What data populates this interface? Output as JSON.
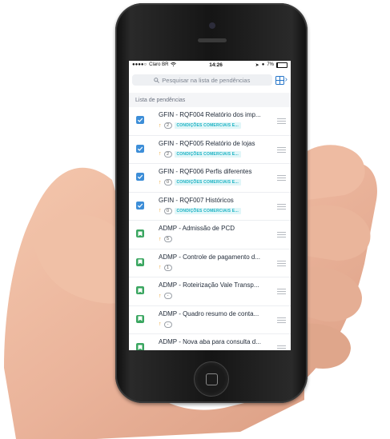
{
  "status_bar": {
    "carrier": "Claro BR",
    "time": "14:26",
    "battery": "7%"
  },
  "search": {
    "placeholder": "Pesquisar na lista de pendências"
  },
  "section_title": "Lista de pendências",
  "items": [
    {
      "title": "GFIN - RQF004 Relatório dos imp...",
      "count": "2",
      "tag": "CONDIÇÕES COMERCIAIS E...",
      "type": "check"
    },
    {
      "title": "GFIN - RQF005 Relatório de lojas",
      "count": "2",
      "tag": "CONDIÇÕES COMERCIAIS E...",
      "type": "check"
    },
    {
      "title": "GFIN - RQF006 Perfis diferentes",
      "count": "0",
      "tag": "CONDIÇÕES COMERCIAIS E...",
      "type": "check"
    },
    {
      "title": "GFIN - RQF007 Históricos",
      "count": "0",
      "tag": "CONDIÇÕES COMERCIAIS E...",
      "type": "check"
    },
    {
      "title": "ADMP - Admissão de PCD",
      "count": "5",
      "tag": "",
      "type": "flag"
    },
    {
      "title": "ADMP - Controle de pagamento d...",
      "count": "1",
      "tag": "",
      "type": "flag"
    },
    {
      "title": "ADMP - Roteirização Vale Transp...",
      "count": "-",
      "tag": "",
      "type": "flag"
    },
    {
      "title": "ADMP - Quadro resumo de conta...",
      "count": "-",
      "tag": "",
      "type": "flag"
    },
    {
      "title": "ADMP - Nova aba para consulta d...",
      "count": "",
      "tag": "",
      "type": "flag"
    }
  ],
  "colors": {
    "checkbox": "#3d8ed8",
    "flag": "#3aa660",
    "tag_text": "#1ab2c3",
    "pin": "#e89c1f",
    "accent": "#2474c8"
  },
  "icons": {
    "search": "search-icon",
    "view": "grid-view-icon",
    "chevron": "chevron-right-icon",
    "check": "checkbox-checked-icon",
    "flag": "bookmark-flag-icon",
    "pin": "pin-icon",
    "handle": "drag-handle-icon"
  }
}
